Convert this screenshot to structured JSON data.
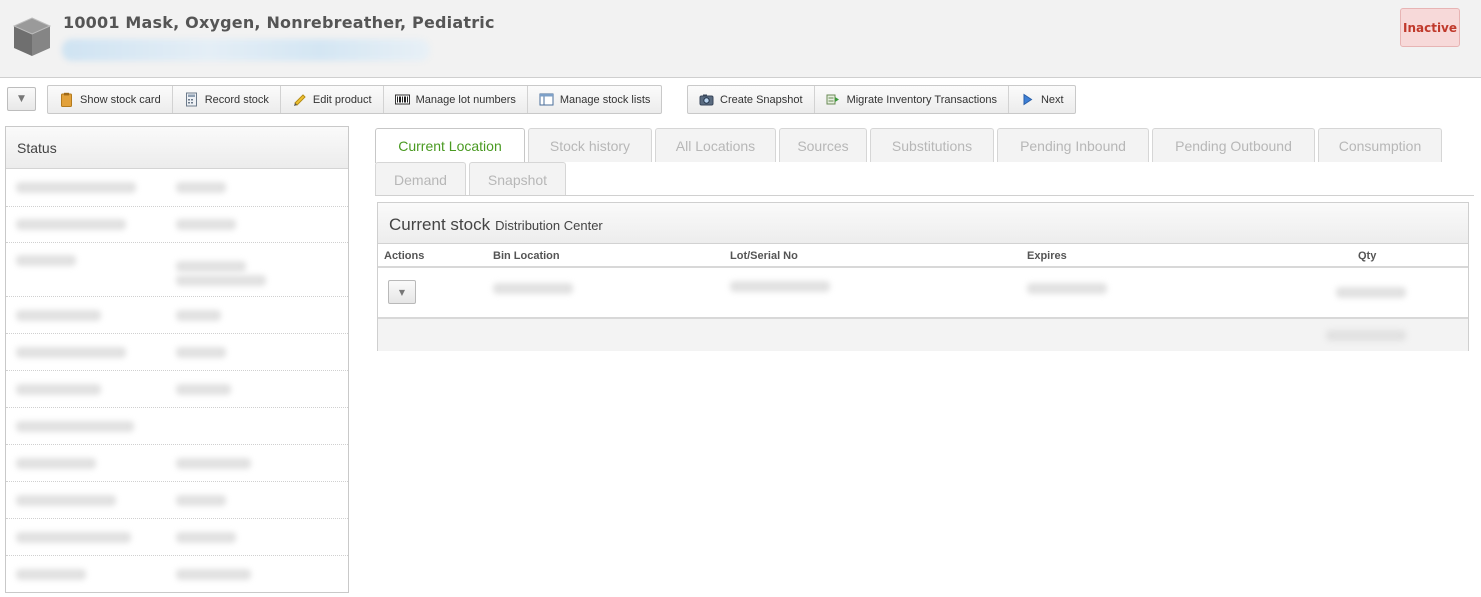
{
  "header": {
    "title": "10001 Mask, Oxygen, Nonrebreather, Pediatric",
    "status": "Inactive",
    "product_icon": "box-icon"
  },
  "toolbar": {
    "menu_toggle_icon": "chevron-down-icon",
    "group1": [
      {
        "label": "Show stock card",
        "icon": "clipboard-icon"
      },
      {
        "label": "Record stock",
        "icon": "calculator-icon"
      },
      {
        "label": "Edit product",
        "icon": "pencil-icon"
      },
      {
        "label": "Manage lot numbers",
        "icon": "barcode-icon"
      },
      {
        "label": "Manage stock lists",
        "icon": "list-icon"
      }
    ],
    "group2": [
      {
        "label": "Create Snapshot",
        "icon": "camera-icon"
      },
      {
        "label": "Migrate Inventory Transactions",
        "icon": "migrate-icon"
      },
      {
        "label": "Next",
        "icon": "play-icon"
      }
    ]
  },
  "status_panel": {
    "title": "Status"
  },
  "tabs": [
    {
      "label": "Current Location",
      "active": true
    },
    {
      "label": "Stock history"
    },
    {
      "label": "All Locations"
    },
    {
      "label": "Sources"
    },
    {
      "label": "Substitutions"
    },
    {
      "label": "Pending Inbound"
    },
    {
      "label": "Pending Outbound"
    },
    {
      "label": "Consumption"
    },
    {
      "label": "Demand"
    },
    {
      "label": "Snapshot"
    }
  ],
  "current_stock": {
    "title": "Current stock",
    "location": "Distribution Center",
    "columns": [
      "Actions",
      "Bin Location",
      "Lot/Serial No",
      "Expires",
      "Qty"
    ]
  },
  "colors": {
    "accent_green": "#4a9a22",
    "inactive_red": "#c0392b",
    "inactive_bg": "#f7d9d9"
  }
}
